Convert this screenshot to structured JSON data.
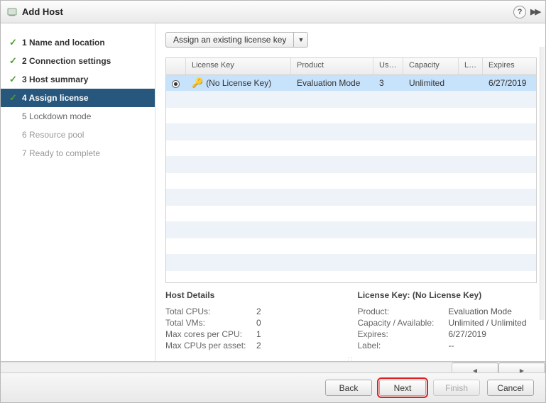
{
  "title": "Add Host",
  "steps": [
    {
      "num": "1",
      "label": "Name and location",
      "state": "completed"
    },
    {
      "num": "2",
      "label": "Connection settings",
      "state": "completed"
    },
    {
      "num": "3",
      "label": "Host summary",
      "state": "completed"
    },
    {
      "num": "4",
      "label": "Assign license",
      "state": "current"
    },
    {
      "num": "5",
      "label": "Lockdown mode",
      "state": "pending"
    },
    {
      "num": "6",
      "label": "Resource pool",
      "state": "pending dim"
    },
    {
      "num": "7",
      "label": "Ready to complete",
      "state": "pending dim"
    }
  ],
  "dropdown_label": "Assign an existing license key",
  "columns": {
    "key": "License Key",
    "product": "Product",
    "usage": "Usa...",
    "capacity": "Capacity",
    "la": "La...",
    "expires": "Expires"
  },
  "rows": [
    {
      "key": "(No License Key)",
      "product": "Evaluation Mode",
      "usage": "3",
      "capacity": "Unlimited",
      "la": "",
      "expires": "6/27/2019",
      "selected": true
    }
  ],
  "host_heading": "Host Details",
  "license_heading": "License Key: (No License Key)",
  "host_details": [
    {
      "k": "Total CPUs:",
      "v": "2"
    },
    {
      "k": "Total VMs:",
      "v": "0"
    },
    {
      "k": "Max cores per CPU:",
      "v": "1"
    },
    {
      "k": "Max CPUs per asset:",
      "v": "2"
    }
  ],
  "license_details": [
    {
      "k": "Product:",
      "v": "Evaluation Mode"
    },
    {
      "k": "Capacity / Available:",
      "v": "Unlimited  / Unlimited"
    },
    {
      "k": "Expires:",
      "v": "6/27/2019"
    },
    {
      "k": "Label:",
      "v": "--"
    }
  ],
  "buttons": {
    "back": "Back",
    "next": "Next",
    "finish": "Finish",
    "cancel": "Cancel"
  }
}
